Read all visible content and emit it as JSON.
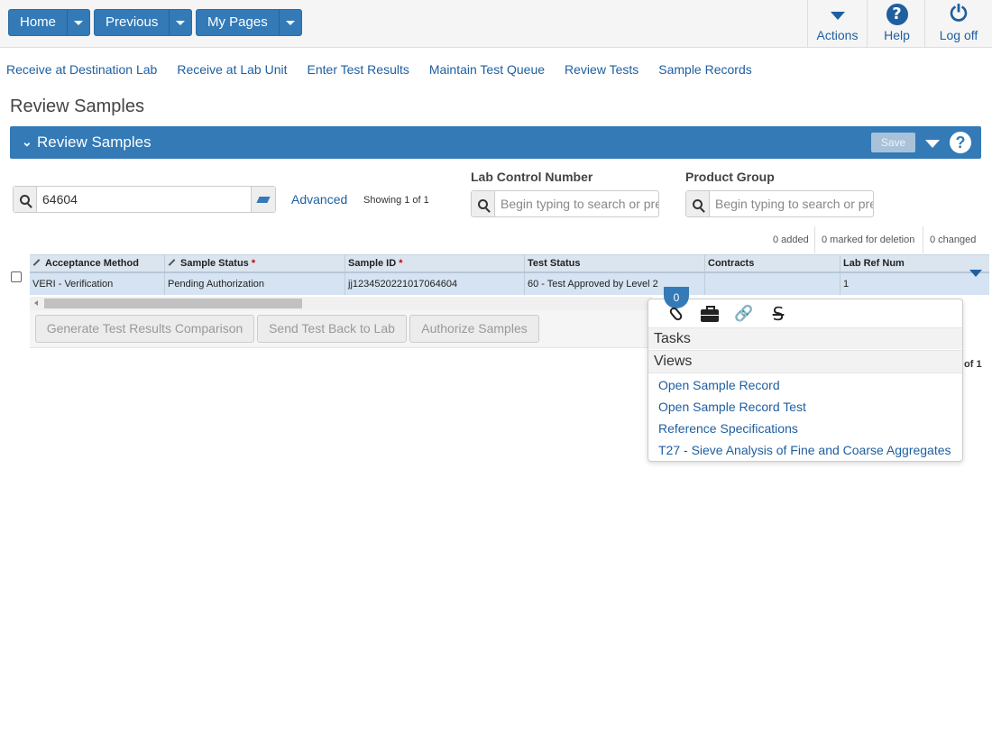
{
  "topbar": {
    "home_label": "Home",
    "previous_label": "Previous",
    "mypages_label": "My Pages",
    "actions_label": "Actions",
    "help_label": "Help",
    "logoff_label": "Log off",
    "help_icon": "?",
    "power_icon": "⏻"
  },
  "navlinks": [
    "Receive at Destination Lab",
    "Receive at Lab Unit",
    "Enter Test Results",
    "Maintain Test Queue",
    "Review Tests",
    "Sample Records"
  ],
  "page_title": "Review Samples",
  "panel": {
    "title": "Review Samples",
    "save_label": "Save",
    "help_icon": "?"
  },
  "search": {
    "value": "64604",
    "advanced_label": "Advanced",
    "showing": "Showing 1 of 1"
  },
  "filters": {
    "lab_control_label": "Lab Control Number",
    "lab_control_placeholder": "Begin typing to search or press",
    "product_group_label": "Product Group",
    "product_group_placeholder": "Begin typing to search or press"
  },
  "counters": {
    "added": "0 added",
    "deleted": "0 marked for deletion",
    "changed": "0 changed"
  },
  "grid": {
    "columns": [
      "Acceptance Method",
      "Sample Status",
      "Sample ID",
      "Test Status",
      "Contracts",
      "Lab Ref Num"
    ],
    "row": {
      "acceptance_method": "VERI - Verification",
      "sample_status": "Pending Authorization",
      "sample_id": "jj1234520221017064604",
      "test_status": "60 - Test Approved by Level 2",
      "contracts": "",
      "lab_ref_num": "1"
    }
  },
  "buttons": {
    "generate": "Generate Test Results Comparison",
    "send_back": "Send Test Back to Lab",
    "authorize": "Authorize Samples"
  },
  "pager_text": "of 1",
  "popup": {
    "badge": "0",
    "tasks_label": "Tasks",
    "views_label": "Views",
    "links": [
      "Open Sample Record",
      "Open Sample Record Test",
      "Reference Specifications",
      "T27 - Sieve Analysis of Fine and Coarse Aggregates"
    ],
    "link_icon": "🔗",
    "strike_icon": "S"
  },
  "colors": {
    "brand_blue": "#337ab7",
    "link_blue": "#1f5fa0",
    "row_highlight": "#d5e3f2"
  }
}
